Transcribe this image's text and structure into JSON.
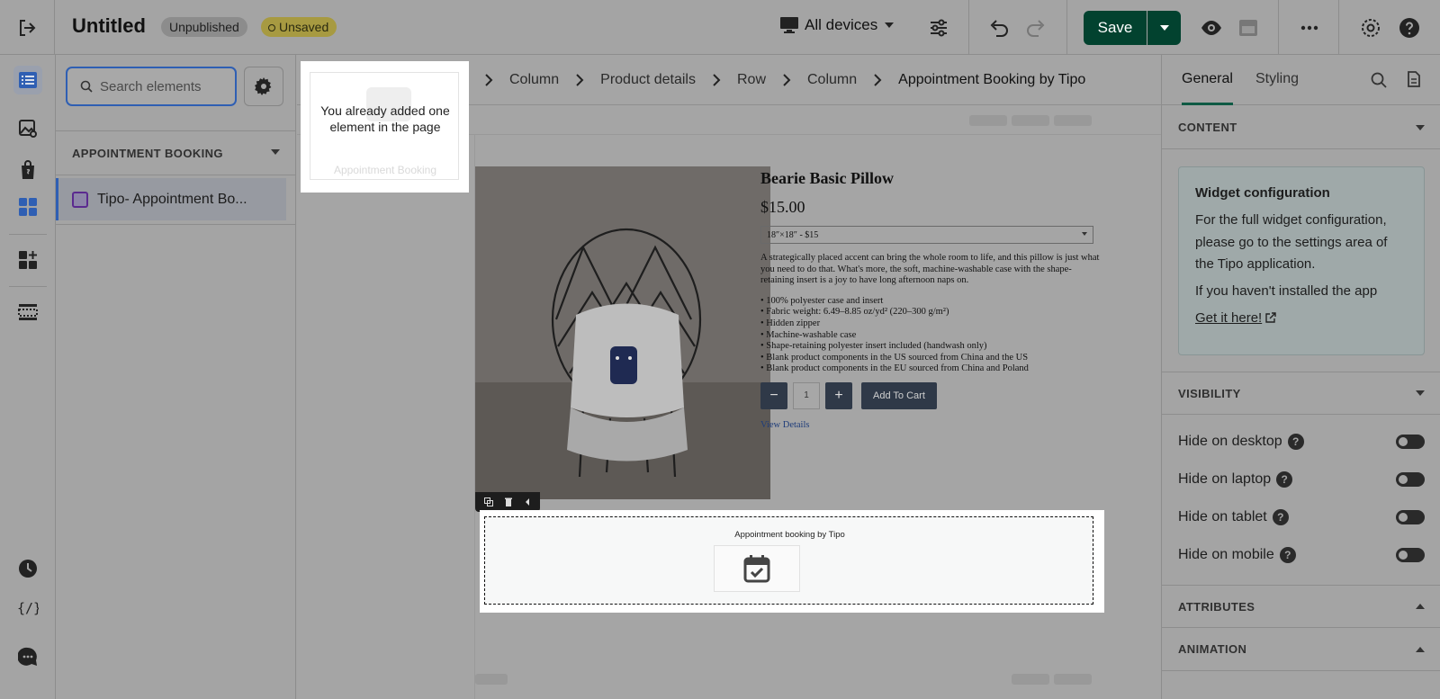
{
  "header": {
    "title": "Untitled",
    "status_published": "Unpublished",
    "status_saved": "Unsaved",
    "device_selector": "All devices",
    "save_label": "Save"
  },
  "left_panel": {
    "search_placeholder": "Search elements",
    "section_title": "APPOINTMENT BOOKING",
    "element_label": "Tipo- Appointment Bo..."
  },
  "tooltip": {
    "message": "You already added one element in the page",
    "faded_label": "Appointment Booking"
  },
  "breadcrumb": [
    "Column",
    "Product details",
    "Row",
    "Column",
    "Appointment Booking by Tipo"
  ],
  "product": {
    "title": "Bearie Basic Pillow",
    "price": "$15.00",
    "variant": "18″×18″ - $15",
    "description": "A strategically placed accent can bring the whole room to life, and this pillow is just what you need to do that. What's more, the soft, machine-washable case with the shape-retaining insert is a joy to have long afternoon naps on.",
    "bullets": [
      "• 100% polyester case and insert",
      "• Fabric weight: 6.49–8.85 oz/yd² (220–300 g/m²)",
      "• Hidden zipper",
      "• Machine-washable case",
      "• Shape-retaining polyester insert included (handwash only)",
      "• Blank product components in the US sourced from China and the US",
      "• Blank product components in the EU sourced from China and Poland"
    ],
    "qty_minus": "−",
    "qty_value": "1",
    "qty_plus": "+",
    "add_to_cart": "Add To Cart",
    "view_details": "View Details"
  },
  "booking_block": {
    "title": "Appointment booking by Tipo"
  },
  "right_panel": {
    "tab_general": "General",
    "tab_styling": "Styling",
    "content_title": "CONTENT",
    "widget_title": "Widget configuration",
    "widget_text": "For the full widget configuration, please go to the settings area of the Tipo application.",
    "widget_text2": "If you haven't installed the app",
    "widget_link": "Get it here!",
    "visibility_title": "VISIBILITY",
    "visibility": [
      {
        "label": "Hide on desktop"
      },
      {
        "label": "Hide on laptop"
      },
      {
        "label": "Hide on tablet"
      },
      {
        "label": "Hide on mobile"
      }
    ],
    "attributes_title": "ATTRIBUTES",
    "animation_title": "ANIMATION"
  },
  "colors": {
    "save": "#02422f",
    "accent_blue": "#2f5fb3",
    "unsaved_badge": "#a79a41"
  }
}
